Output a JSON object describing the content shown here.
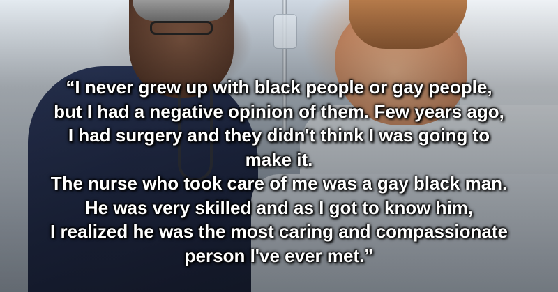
{
  "quote": {
    "lines": [
      "“I never grew up with black people or gay people,",
      "but I had a negative opinion of them. Few years ago,",
      "I had surgery and they didn't think I was going to",
      "make it.",
      "The nurse who took care of me was a gay black man.",
      "He was very skilled and as I got to know him,",
      "I realized he was the most caring and compassionate",
      "person I've ever met.”"
    ]
  },
  "colors": {
    "text": "#ffffff",
    "text_shadow": "#000000",
    "scrubs": "#2f3d63"
  }
}
